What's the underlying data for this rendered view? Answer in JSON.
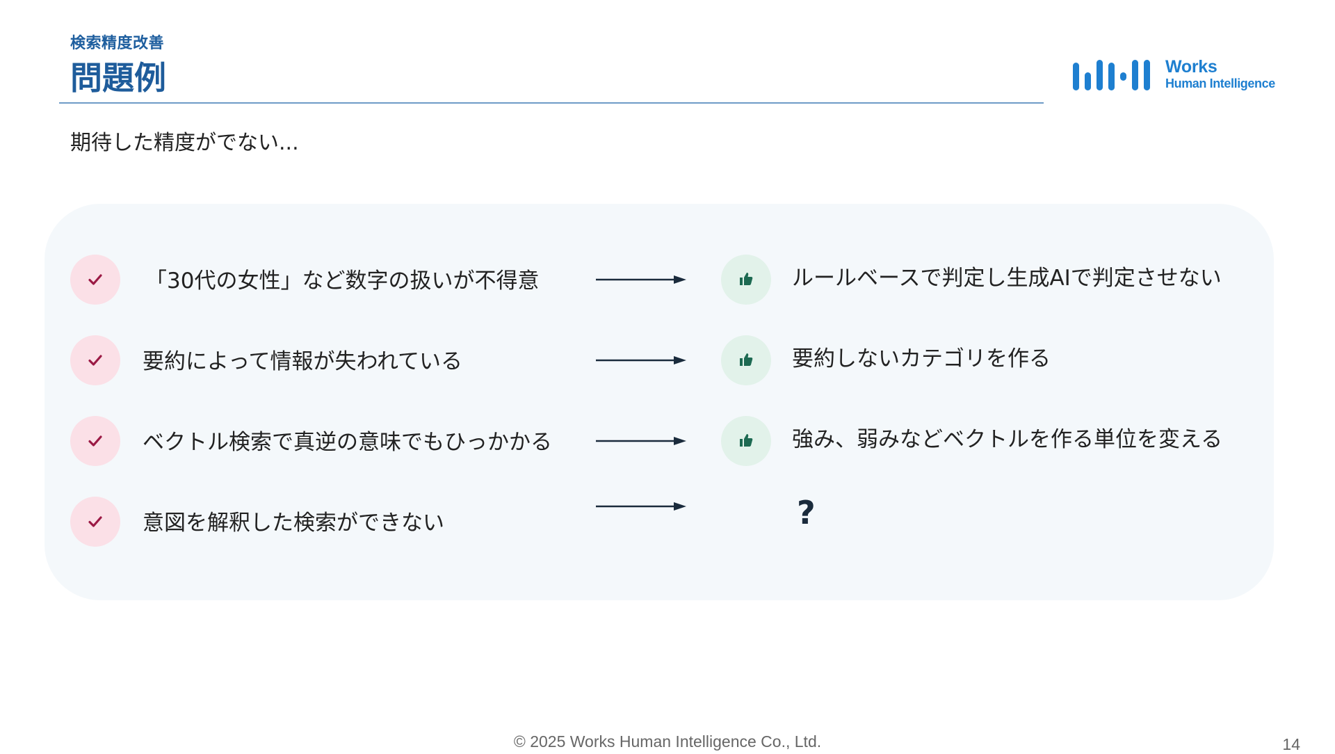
{
  "header": {
    "section_label": "検索精度改善",
    "title": "問題例",
    "subtitle": "期待した精度がでない..."
  },
  "logo": {
    "name": "Works",
    "sub": "Human Intelligence",
    "color": "#1e7fd0"
  },
  "rows": [
    {
      "problem": "「30代の女性」など数字の扱いが不得意",
      "solution": "ルールベースで判定し生成AIで判定させない",
      "solution_icon": "thumbs-up-icon"
    },
    {
      "problem": "要約によって情報が失われている",
      "solution": "要約しないカテゴリを作る",
      "solution_icon": "thumbs-up-icon"
    },
    {
      "problem": "ベクトル検索で真逆の意味でもひっかかる",
      "solution": "強み、弱みなどベクトルを作る単位を変える",
      "solution_icon": "thumbs-up-icon"
    },
    {
      "problem": "意図を解釈した検索ができない",
      "solution": "?",
      "solution_icon": "none"
    }
  ],
  "footer": {
    "copyright": "© 2025 Works Human Intelligence Co., Ltd.",
    "page_number": "14"
  },
  "colors": {
    "title": "#1e5c9b",
    "check_bg": "#fbe0e7",
    "check_mark": "#9b1a45",
    "thumb_bg": "#e2f2ea",
    "thumb_mark": "#1d6a52",
    "panel_bg": "#f4f8fb"
  }
}
